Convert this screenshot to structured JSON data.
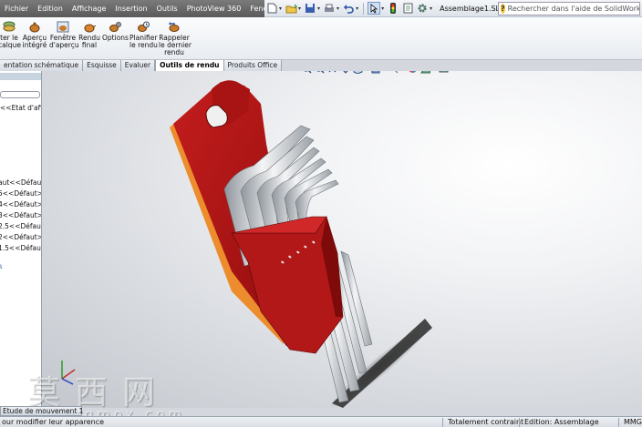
{
  "menu": [
    "Fichier",
    "Edition",
    "Affichage",
    "Insertion",
    "Outils",
    "PhotoView 360",
    "Fenêtre",
    "?"
  ],
  "document_title": "Assemblage1.SL...",
  "search_placeholder": "Rechercher dans l'aide de SolidWorks",
  "ribbon": {
    "buttons": [
      {
        "label": "ter le\ncalque"
      },
      {
        "label": "Aperçu\nintégré"
      },
      {
        "label": "Fenêtre\nd'aperçu"
      },
      {
        "label": "Rendu\nfinal"
      },
      {
        "label": "Options"
      },
      {
        "label": "Planifier\nle rendu"
      },
      {
        "label": "Rappeler\nle dernier\nrendu"
      }
    ]
  },
  "tabs": [
    {
      "label": "entation schématique",
      "active": false
    },
    {
      "label": "Esquisse",
      "active": false
    },
    {
      "label": "Evaluer",
      "active": false
    },
    {
      "label": "Outils de rendu",
      "active": true
    },
    {
      "label": "Produits Office",
      "active": false
    }
  ],
  "tree": {
    "display_state": "<<Etat d'affic",
    "items": [
      "aut<<Défaut>",
      "5<<Défaut>_",
      "4<<Défaut>_",
      "3<<Défaut>_",
      "2.5<<Défaut>",
      "2<<Défaut>_",
      "1.5<<Défaut>"
    ]
  },
  "motion_tab": "Etude de mouvement 1",
  "status": {
    "hint": "our modifier leur apparence",
    "constraint": "Totalement contraint",
    "edition": "Edition: Assemblage",
    "units": "MMG"
  },
  "watermark": {
    "text": "莫西网",
    "url": "www.cgmox.com"
  },
  "colors": {
    "holder": "#b01515",
    "holder_dark": "#7a0a0a",
    "steel": "#d9dcdf",
    "steel_dark": "#8f959c",
    "orange_edge": "#f0a040"
  }
}
